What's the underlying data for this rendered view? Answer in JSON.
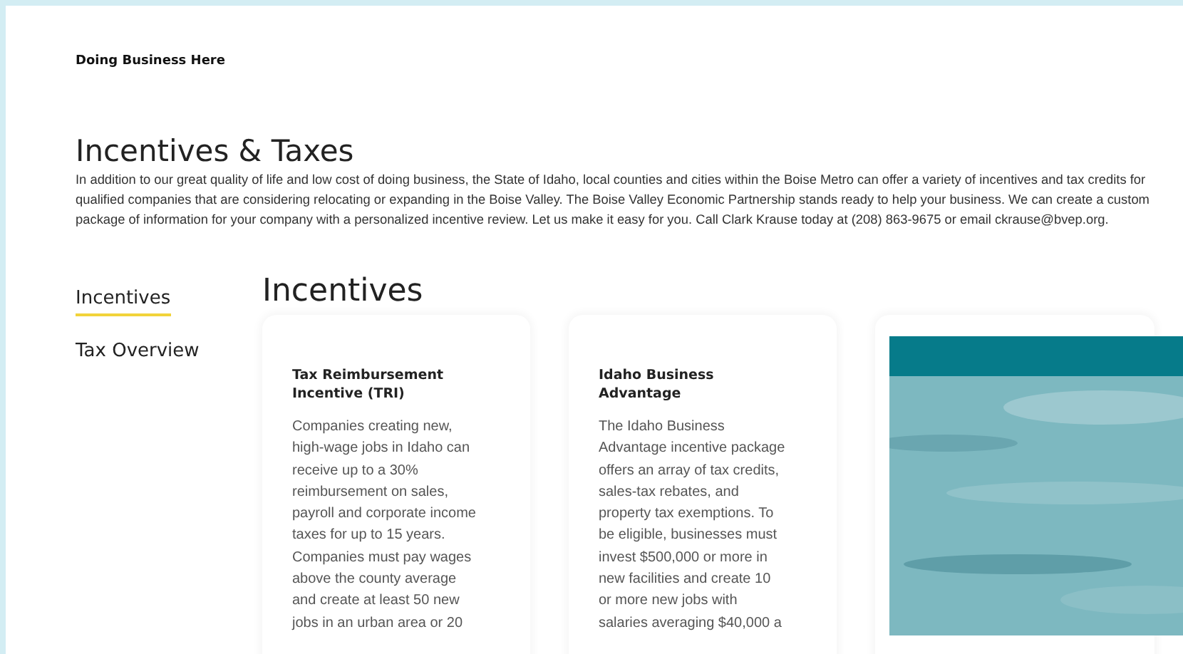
{
  "breadcrumb": "Doing Business Here",
  "page_title": "Incentives & Taxes",
  "intro": "In addition to our great quality of life and low cost of doing business, the State of Idaho, local counties and cities within the Boise Metro can offer a variety of incentives and tax credits for qualified companies that are considering relocating or expanding in the Boise Valley. The Boise Valley Economic Partnership stands ready to help your business. We can create a custom package of information for your company with a personalized incentive review. Let us make it easy for you. Call Clark Krause today at (208) 863-9675 or email ckrause@bvep.org.",
  "sidebar": {
    "items": [
      {
        "label": "Incentives",
        "selected": true
      },
      {
        "label": "Tax Overview",
        "selected": false
      }
    ]
  },
  "section_title": "Incentives",
  "cards": [
    {
      "kind": "text",
      "title": "Tax Reimbursement Incentive (TRI)",
      "body": [
        "Companies creating new,",
        "high-wage jobs in Idaho can",
        "receive up to a 30%",
        "reimbursement on sales,",
        "payroll and corporate income",
        "taxes for up to 15 years.",
        "Companies must pay wages",
        "above the county average",
        "and create at least 50 new",
        "jobs in an urban area or 20"
      ]
    },
    {
      "kind": "text",
      "title": "Idaho Business Advantage",
      "body": [
        "The Idaho Business",
        "Advantage incentive package",
        "offers an array of tax credits,",
        "sales-tax rebates, and",
        "property tax exemptions. To",
        "be eligible, businesses must",
        "invest $500,000 or more in",
        "new facilities and create 10",
        "or more new jobs with",
        "salaries averaging $40,000 a"
      ]
    },
    {
      "kind": "picture"
    }
  ]
}
